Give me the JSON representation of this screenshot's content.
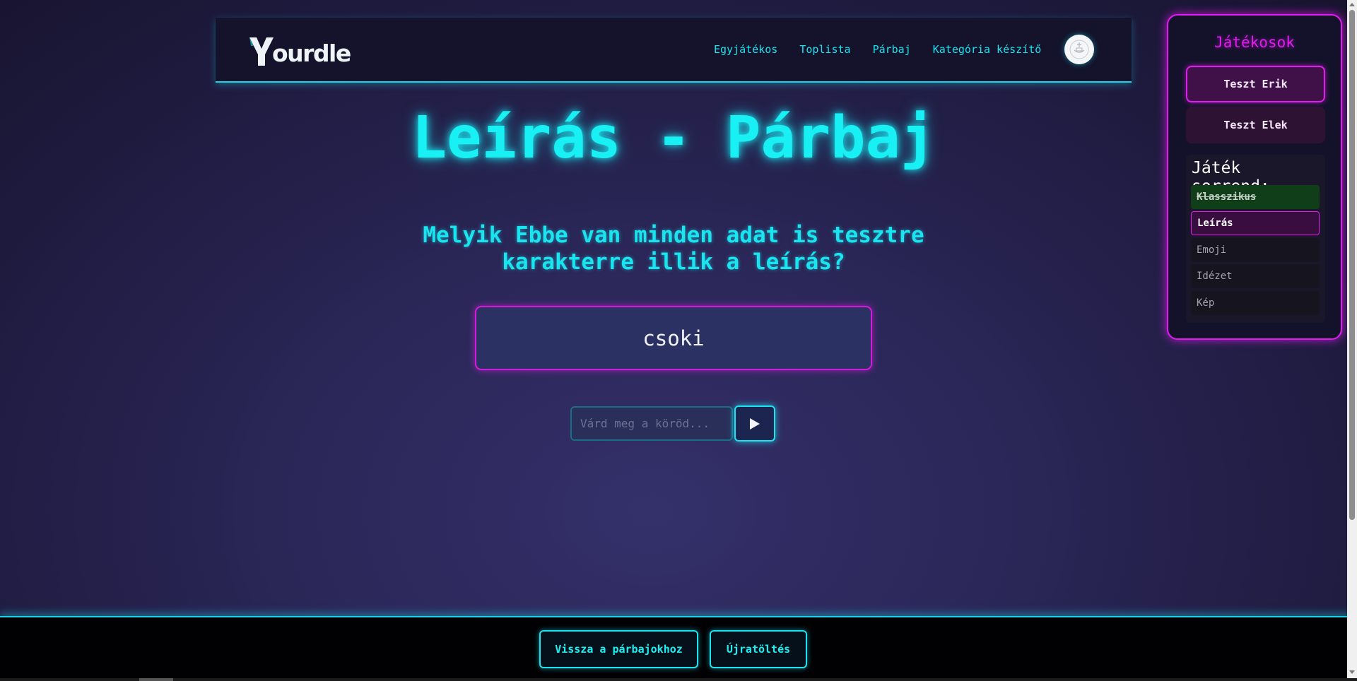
{
  "header": {
    "logo_text": "ourdle",
    "nav": [
      {
        "label": "Egyjátékos"
      },
      {
        "label": "Toplista"
      },
      {
        "label": "Párbaj"
      },
      {
        "label": "Kategória készítő"
      }
    ]
  },
  "main": {
    "title": "Leírás - Párbaj",
    "question_line1": "Melyik Ebbe van minden adat is tesztre",
    "question_line2": "karakterre illik a leírás?",
    "hint": "csoki",
    "guess_placeholder": "Várd meg a köröd..."
  },
  "panel": {
    "title": "Játékosok",
    "players": [
      "Teszt Erik",
      "Teszt Elek"
    ],
    "order_title": "Játék sorrend:",
    "order": [
      {
        "label": "Klasszikus",
        "state": "done"
      },
      {
        "label": "Leírás",
        "state": "current"
      },
      {
        "label": "Emoji",
        "state": "pending"
      },
      {
        "label": "Idézet",
        "state": "pending"
      },
      {
        "label": "Kép",
        "state": "pending"
      }
    ]
  },
  "footer": {
    "back_label": "Vissza a párbajokhoz",
    "reload_label": "Újratöltés"
  },
  "colors": {
    "accent_cyan": "#19e4f0",
    "accent_magenta": "#e21cf0",
    "done_green": "#103e19"
  }
}
